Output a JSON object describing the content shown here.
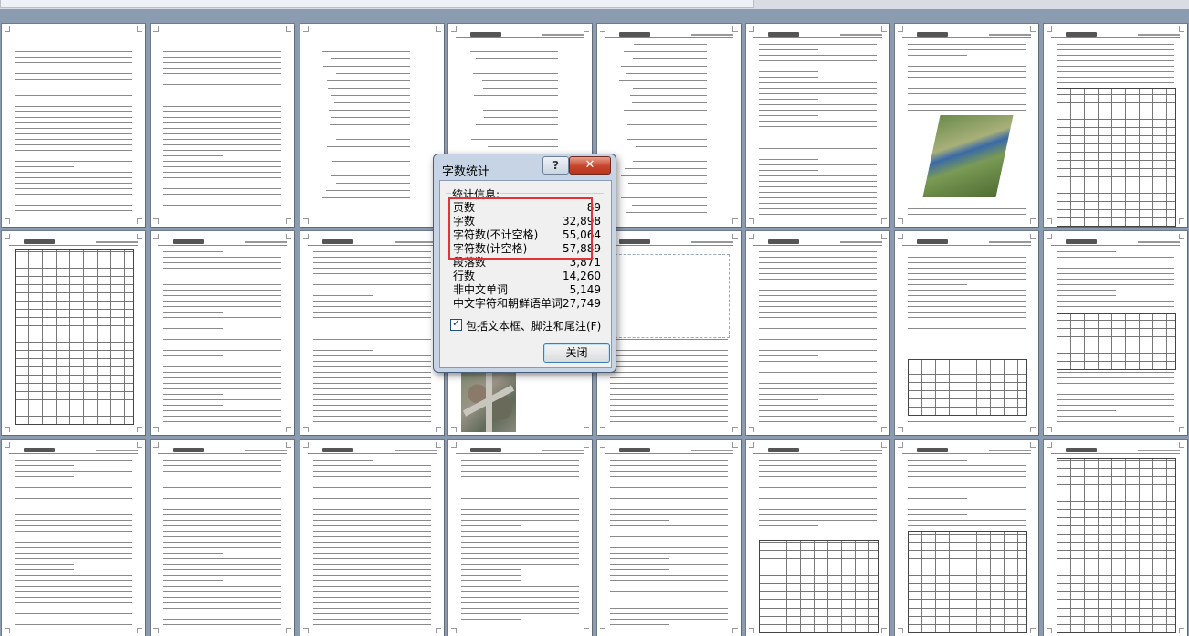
{
  "dialog": {
    "title": "字数统计",
    "help_label": "?",
    "close_icon": "close-icon",
    "group_label": "统计信息:",
    "stats": [
      {
        "label": "页数",
        "value": "89"
      },
      {
        "label": "字数",
        "value": "32,898"
      },
      {
        "label": "字符数(不计空格)",
        "value": "55,064"
      },
      {
        "label": "字符数(计空格)",
        "value": "57,889"
      },
      {
        "label": "段落数",
        "value": "3,871"
      },
      {
        "label": "行数",
        "value": "14,260"
      },
      {
        "label": "非中文单词",
        "value": "5,149"
      },
      {
        "label": "中文字符和朝鲜语单词",
        "value": "27,749"
      }
    ],
    "include_textboxes_label": "包括文本框、脚注和尾注(F)",
    "include_textboxes_checked": true,
    "checkmark": "✓",
    "close_button_label": "关闭",
    "close_x": "✕",
    "highlight_color": "#e0343a"
  },
  "document_pages": {
    "visible_count": 24
  }
}
